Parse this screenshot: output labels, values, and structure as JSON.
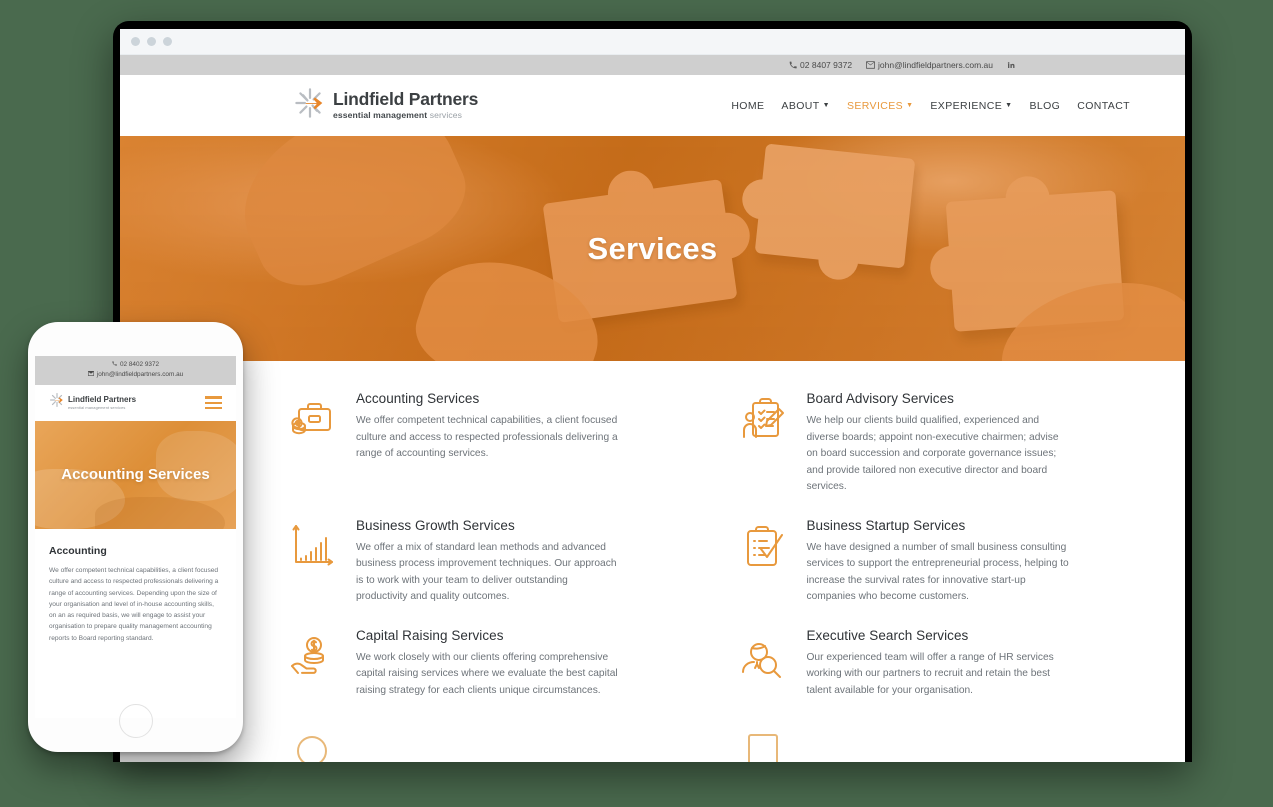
{
  "theme": {
    "background": "#4a6a4e",
    "accent": "#E8993D",
    "topbar_bg": "#cfcfcf",
    "heading": "#2f3337",
    "body_text": "#6d7379"
  },
  "browser": {
    "dots": [
      "dot-red",
      "dot-yellow",
      "dot-green"
    ]
  },
  "site": {
    "topbar": {
      "phone": "02 8407 9372",
      "phone_icon": "phone-icon",
      "email": "john@lindfieldpartners.com.au",
      "email_icon": "envelope-icon",
      "linkedin_icon": "linkedin-icon"
    },
    "logo": {
      "mark": "starburst-arrow-logo-icon",
      "name": "Lindfield Partners",
      "tagline_bold": "essential management",
      "tagline_light": "services"
    },
    "nav": [
      {
        "label": "HOME",
        "has_dropdown": false,
        "active": false
      },
      {
        "label": "ABOUT",
        "has_dropdown": true,
        "active": false
      },
      {
        "label": "SERVICES",
        "has_dropdown": true,
        "active": true
      },
      {
        "label": "EXPERIENCE",
        "has_dropdown": true,
        "active": false
      },
      {
        "label": "BLOG",
        "has_dropdown": false,
        "active": false
      },
      {
        "label": "CONTACT",
        "has_dropdown": false,
        "active": false
      }
    ],
    "hero": {
      "title": "Services",
      "image_description": "hands-assembling-jigsaw-puzzle-orange-duotone"
    },
    "services": [
      {
        "icon": "briefcase-coins-icon",
        "title": "Accounting Services",
        "description": "We offer competent technical capabilities, a client focused culture and access to respected professionals delivering a range of accounting services."
      },
      {
        "icon": "clipboard-person-pencil-icon",
        "title": "Board Advisory Services",
        "description": "We help our clients build qualified, experienced and diverse boards; appoint non-executive chairmen; advise on board succession and corporate governance issues; and provide tailored non executive director and board services."
      },
      {
        "icon": "bar-chart-growth-icon",
        "title": "Business Growth Services",
        "description": "We offer a mix of standard lean methods and advanced business process improvement techniques. Our approach is to work with your team to deliver outstanding productivity and quality outcomes."
      },
      {
        "icon": "clipboard-check-icon",
        "title": "Business Startup Services",
        "description": "We have designed a number of small business consulting services to support the entrepreneurial process, helping to increase the survival rates for innovative start-up companies who become customers."
      },
      {
        "icon": "hand-coins-dollar-icon",
        "title": "Capital Raising Services",
        "description": "We work closely with our clients offering comprehensive capital raising services where we evaluate the best capital raising strategy for each clients unique circumstances."
      },
      {
        "icon": "person-magnifier-icon",
        "title": "Executive Search Services",
        "description": "Our experienced team will offer a range of HR services working with our partners to recruit and retain the best talent available for your organisation."
      }
    ]
  },
  "phone": {
    "topbar": {
      "phone": "02 8402 9372",
      "phone_icon": "phone-icon",
      "email": "john@lindfieldpartners.com.au",
      "email_icon": "envelope-icon"
    },
    "logo": {
      "mark": "starburst-arrow-logo-icon",
      "name": "Lindfield Partners",
      "tagline": "essential management services"
    },
    "menu_icon": "hamburger-menu-icon",
    "hero": {
      "title": "Accounting Services",
      "image_description": "desk-with-calculator-and-paperwork-orange-duotone"
    },
    "body": {
      "heading": "Accounting",
      "text": "We offer competent technical capabilities, a client focused culture and access to respected professionals delivering a range of accounting services. Depending upon the size of your organisation and level of in-house accounting skills, on an as required basis, we will engage to assist your organisation to prepare quality management accounting reports to Board reporting standard."
    },
    "home_button": "home-button"
  }
}
